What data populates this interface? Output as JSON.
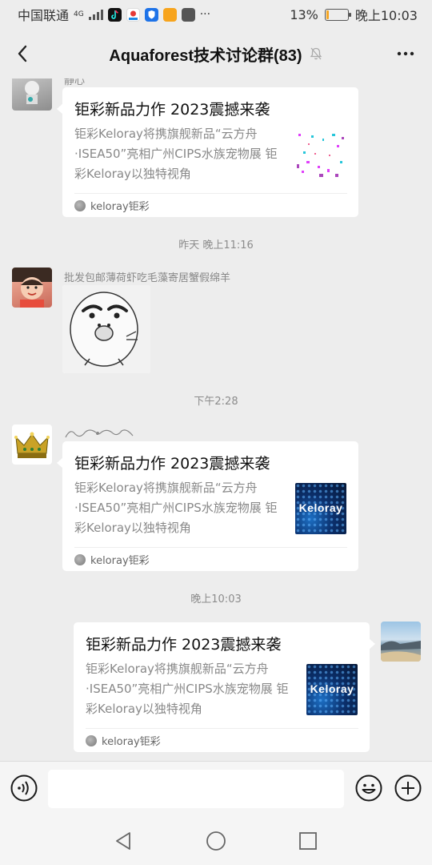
{
  "status_bar": {
    "carrier": "中国联通",
    "network": "4G",
    "battery_percent": "13%",
    "battery_level": 0.13,
    "time": "晚上10:03",
    "overflow": "···"
  },
  "header": {
    "title": "Aquaforest技术讨论群(83)",
    "mute_icon": "bell-off-icon",
    "back_icon": "chevron-left-icon",
    "more_icon": "more-horizontal-icon"
  },
  "messages": [
    {
      "sender": "静心",
      "card_title": "钜彩新品力作 2023震撼来袭",
      "card_desc": "钜彩Keloray将携旗舰新品“云方舟·ISEA50”亮相广州CIPS水族宠物展 钜彩Keloray以独特视角",
      "source": "keloray钜彩"
    },
    {
      "timestamp": "昨天 晚上11:16"
    },
    {
      "sender": "批发包邮薄荷虾吃毛藻寄居蟹假绵羊"
    },
    {
      "timestamp": "下午2:28"
    },
    {
      "card_title": "钜彩新品力作 2023震撼来袭",
      "card_desc": "钜彩Keloray将携旗舰新品“云方舟·ISEA50”亮相广州CIPS水族宠物展 钜彩Keloray以独特视角",
      "source": "keloray钜彩",
      "thumb_text": "Keloray"
    },
    {
      "timestamp": "晚上10:03"
    },
    {
      "card_title": "钜彩新品力作 2023震撼来袭",
      "card_desc": "钜彩Keloray将携旗舰新品“云方舟·ISEA50”亮相广州CIPS水族宠物展 钜彩Keloray以独特视角",
      "source": "keloray钜彩",
      "thumb_text": "Keloray"
    }
  ],
  "input_bar": {
    "placeholder": "",
    "voice_icon": "voice-icon",
    "emoji_icon": "emoji-icon",
    "plus_icon": "plus-circle-icon"
  },
  "colors": {
    "background": "#ededed",
    "bubble": "#ffffff",
    "battery": "#f5a623"
  }
}
